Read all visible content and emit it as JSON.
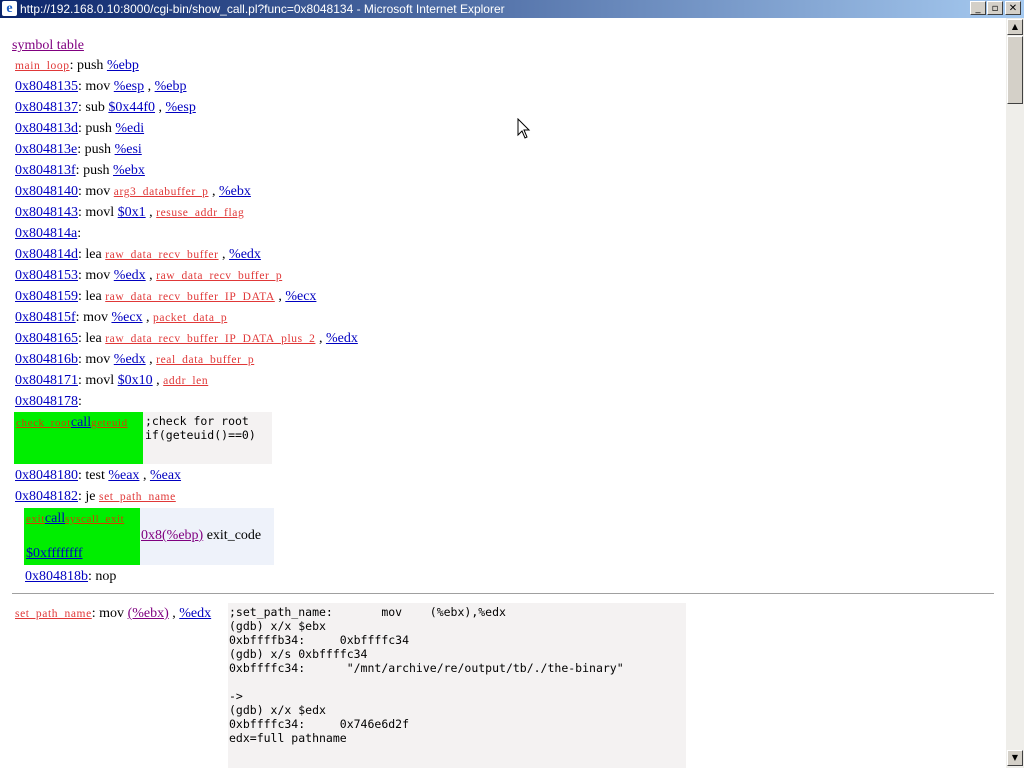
{
  "window": {
    "title": "http://192.168.0.10:8000/cgi-bin/show_call.pl?func=0x8048134 - Microsoft Internet Explorer",
    "minimize": "_",
    "maximize": "▫",
    "close": "✕"
  },
  "page": {
    "symbol_table_link": "symbol table",
    "lines": {
      "l1_label": "main_loop",
      "l1_instr": "push",
      "l1_op1": "%ebp",
      "l2_addr": "0x8048135",
      "l2_instr": "mov",
      "l2_op1": "%esp",
      "l2_op2": "%ebp",
      "l3_addr": "0x8048137",
      "l3_instr": "sub",
      "l3_op1": "$0x44f0",
      "l3_op2": "%esp",
      "l4_addr": "0x804813d",
      "l4_instr": "push",
      "l4_op1": "%edi",
      "l5_addr": "0x804813e",
      "l5_instr": "push",
      "l5_op1": "%esi",
      "l6_addr": "0x804813f",
      "l6_instr": "push",
      "l6_op1": "%ebx",
      "l7_addr": "0x8048140",
      "l7_instr": "mov",
      "l7_op1": "arg3_databuffer_p",
      "l7_op2": "%ebx",
      "l8_addr": "0x8048143",
      "l8_instr": "movl",
      "l8_op1": "$0x1",
      "l8_op2": "resuse_addr_flag",
      "l9_addr": "0x804814a",
      "l10_addr": "0x804814d",
      "l10_instr": "lea",
      "l10_op1": "raw_data_recv_buffer",
      "l10_op2": "%edx",
      "l11_addr": "0x8048153",
      "l11_instr": "mov",
      "l11_op1": "%edx",
      "l11_op2": "raw_data_recv_buffer_p",
      "l12_addr": "0x8048159",
      "l12_instr": "lea",
      "l12_op1": "raw_data_recv_buffer_IP_DATA",
      "l12_op2": "%ecx",
      "l13_addr": "0x804815f",
      "l13_instr": "mov",
      "l13_op1": "%ecx",
      "l13_op2": "packet_data_p",
      "l14_addr": "0x8048165",
      "l14_instr": "lea",
      "l14_op1": "raw_data_recv_buffer_IP_DATA_plus_2",
      "l14_op2": "%edx",
      "l15_addr": "0x804816b",
      "l15_instr": "mov",
      "l15_op1": "%edx",
      "l15_op2": "real_data_buffer_p",
      "l16_addr": "0x8048171",
      "l16_instr": "movl",
      "l16_op1": "$0x10",
      "l16_op2": "addr_len",
      "l17_addr": "0x8048178",
      "l20_addr": "0x8048180",
      "l20_instr": "test",
      "l20_op1": "%eax",
      "l20_op2": "%eax",
      "l21_addr": "0x8048182",
      "l21_instr": "je",
      "l21_op1": "set_path_name",
      "l22_addr": "0x804818b",
      "l22_instr": "nop"
    },
    "call1": {
      "sym_left": "check_root",
      "call_label": "call",
      "sym_right": "geteuid",
      "comment": ";check for root\nif(geteuid()==0)"
    },
    "call2": {
      "sym_left": "exit",
      "call_label": "call",
      "sym_right": "syscall_exit",
      "arg": "$0xffffffff",
      "arg2": "0x8(%ebp)",
      "arg2_text": "exit_code"
    },
    "section2": {
      "label": "set_path_name",
      "instr": "mov",
      "op1": "(%ebx)",
      "op2": "%edx",
      "comment": ";set_path_name:       mov    (%ebx),%edx\n(gdb) x/x $ebx\n0xbffffb34:     0xbffffc34\n(gdb) x/s 0xbffffc34\n0xbffffc34:      \"/mnt/archive/re/output/tb/./the-binary\"\n\n->\n(gdb) x/x $edx\n0xbffffc34:     0x746e6d2f\nedx=full pathname"
    }
  }
}
